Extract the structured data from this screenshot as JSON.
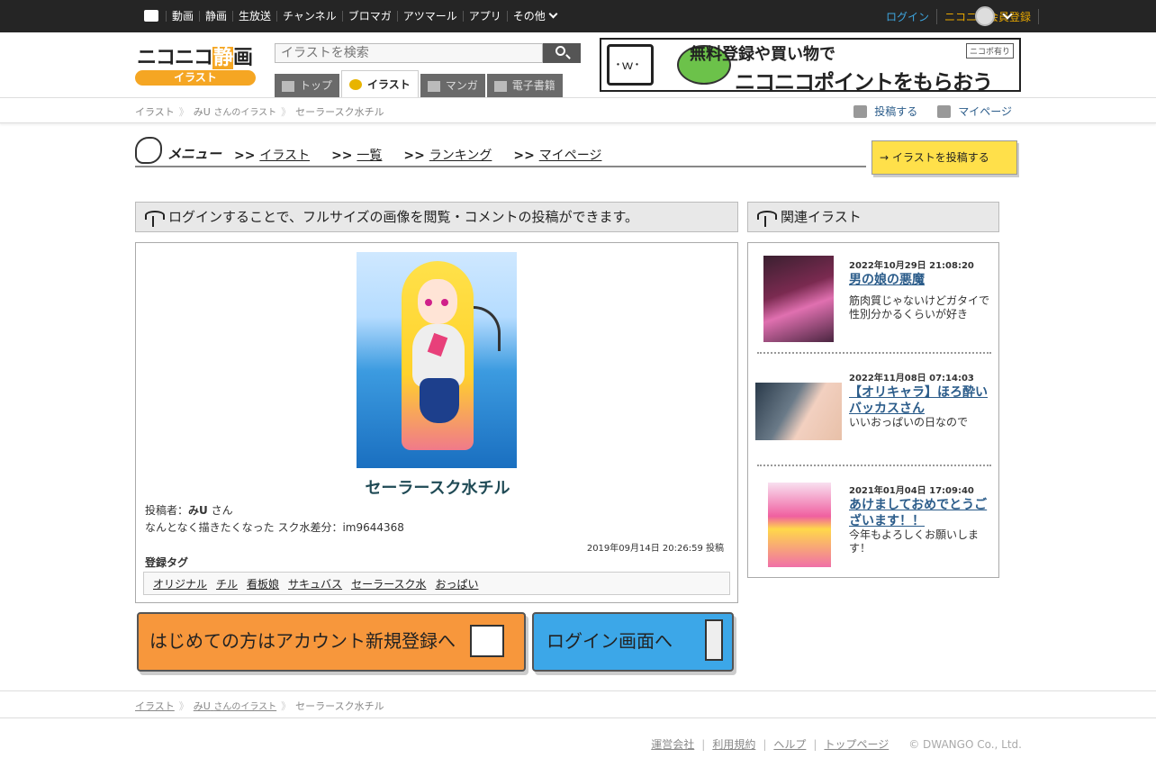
{
  "topbar": {
    "nav": [
      "動画",
      "静画",
      "生放送",
      "チャンネル",
      "ブロマガ",
      "アツマール",
      "アプリ",
      "その他"
    ],
    "login": "ログイン",
    "register": "ニコニコ会員登録"
  },
  "logo": {
    "text_pre": "ニコニコ",
    "text_sei": "静",
    "text_post": "画",
    "sub": "イラスト"
  },
  "search": {
    "placeholder": "イラストを検索"
  },
  "tabs": [
    "トップ",
    "イラスト",
    "マンガ",
    "電子書籍"
  ],
  "banner": {
    "line1": "無料登録や買い物で",
    "line2": "ニコニコポイントをもらおう",
    "tag": "ニコポ有り"
  },
  "breadcrumb": {
    "root": "イラスト",
    "user": "みU",
    "user_suffix": "さんのイラスト",
    "current": "セーラースク水チル"
  },
  "header_actions": {
    "post": "投稿する",
    "mypage": "マイページ"
  },
  "menu": {
    "title": "メニュー",
    "links": [
      ">> イラスト",
      ">> 一覧",
      ">> ランキング",
      ">> マイページ"
    ],
    "link_prefix": ">>",
    "link_labels": [
      "イラスト",
      "一覧",
      "ランキング",
      "マイページ"
    ],
    "post_button": "イラストを投稿する"
  },
  "notice": "ログインすることで、フルサイズの画像を閲覧・コメントの投稿ができます。",
  "illust": {
    "title": "セーラースク水チル",
    "poster_label": "投稿者：",
    "poster_name": "みU",
    "poster_suffix": "さん",
    "description": "なんとなく描きたくなった スク水差分：im9644368",
    "posted": "2019年09月14日 20:26:59 投稿",
    "tags_label": "登録タグ",
    "tags": [
      "オリジナル",
      "チル",
      "看板娘",
      "サキュバス",
      "セーラースク水",
      "おっぱい"
    ]
  },
  "buttons": {
    "register": "はじめての方はアカウント新規登録へ",
    "login": "ログイン画面へ"
  },
  "related": {
    "title": "関連イラスト",
    "items": [
      {
        "date": "2022年10月29日 21:08:20",
        "title": "男の娘の悪魔",
        "desc": "筋肉質じゃないけどガタイで性別分かるくらいが好き"
      },
      {
        "date": "2022年11月08日 07:14:03",
        "title": "【オリキャラ】ほろ酔いバッカスさん",
        "desc": "いいおっぱいの日なので"
      },
      {
        "date": "2021年01月04日 17:09:40",
        "title": "あけましておめでとうございます！！",
        "desc": "今年もよろしくお願いします！"
      }
    ]
  },
  "footer": {
    "links": [
      "運営会社",
      "利用規約",
      "ヘルプ",
      "トップページ"
    ],
    "copyright": "© DWANGO Co., Ltd."
  }
}
